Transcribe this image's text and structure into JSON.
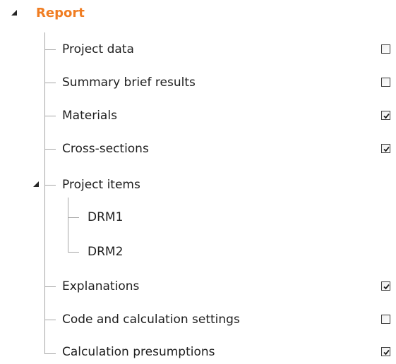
{
  "tree": {
    "root": {
      "label": "Report",
      "expanded": true
    },
    "items": [
      {
        "label": "Project data",
        "checked": false,
        "has_checkbox": true
      },
      {
        "label": "Summary brief results",
        "checked": false,
        "has_checkbox": true
      },
      {
        "label": "Materials",
        "checked": true,
        "has_checkbox": true
      },
      {
        "label": "Cross-sections",
        "checked": true,
        "has_checkbox": true
      },
      {
        "label": "Project items",
        "expanded": true,
        "has_checkbox": false,
        "children": [
          {
            "label": "DRM1"
          },
          {
            "label": "DRM2"
          }
        ]
      },
      {
        "label": "Explanations",
        "checked": true,
        "has_checkbox": true
      },
      {
        "label": "Code and calculation settings",
        "checked": false,
        "has_checkbox": true
      },
      {
        "label": "Calculation presumptions",
        "checked": true,
        "has_checkbox": true
      }
    ]
  },
  "colors": {
    "root_label": "#f07d22",
    "text": "#1e1e1e",
    "connector_line": "#a6a6a6",
    "checkbox_border": "#3c3c3c"
  }
}
